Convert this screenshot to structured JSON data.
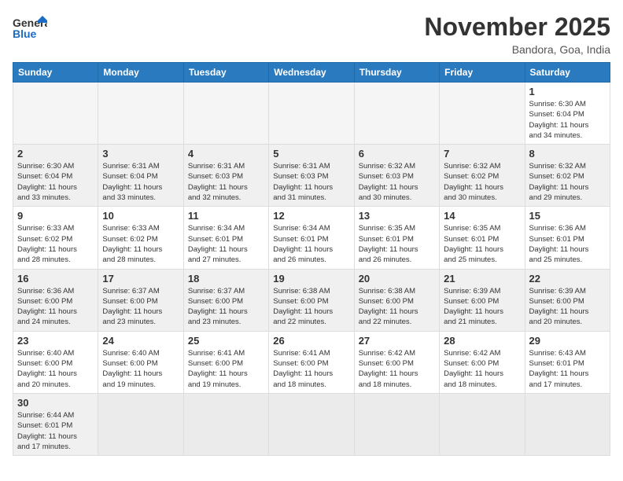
{
  "header": {
    "logo_general": "General",
    "logo_blue": "Blue",
    "title": "November 2025",
    "subtitle": "Bandora, Goa, India"
  },
  "weekdays": [
    "Sunday",
    "Monday",
    "Tuesday",
    "Wednesday",
    "Thursday",
    "Friday",
    "Saturday"
  ],
  "weeks": [
    [
      {
        "day": "",
        "info": ""
      },
      {
        "day": "",
        "info": ""
      },
      {
        "day": "",
        "info": ""
      },
      {
        "day": "",
        "info": ""
      },
      {
        "day": "",
        "info": ""
      },
      {
        "day": "",
        "info": ""
      },
      {
        "day": "1",
        "info": "Sunrise: 6:30 AM\nSunset: 6:04 PM\nDaylight: 11 hours\nand 34 minutes."
      }
    ],
    [
      {
        "day": "2",
        "info": "Sunrise: 6:30 AM\nSunset: 6:04 PM\nDaylight: 11 hours\nand 33 minutes."
      },
      {
        "day": "3",
        "info": "Sunrise: 6:31 AM\nSunset: 6:04 PM\nDaylight: 11 hours\nand 33 minutes."
      },
      {
        "day": "4",
        "info": "Sunrise: 6:31 AM\nSunset: 6:03 PM\nDaylight: 11 hours\nand 32 minutes."
      },
      {
        "day": "5",
        "info": "Sunrise: 6:31 AM\nSunset: 6:03 PM\nDaylight: 11 hours\nand 31 minutes."
      },
      {
        "day": "6",
        "info": "Sunrise: 6:32 AM\nSunset: 6:03 PM\nDaylight: 11 hours\nand 30 minutes."
      },
      {
        "day": "7",
        "info": "Sunrise: 6:32 AM\nSunset: 6:02 PM\nDaylight: 11 hours\nand 30 minutes."
      },
      {
        "day": "8",
        "info": "Sunrise: 6:32 AM\nSunset: 6:02 PM\nDaylight: 11 hours\nand 29 minutes."
      }
    ],
    [
      {
        "day": "9",
        "info": "Sunrise: 6:33 AM\nSunset: 6:02 PM\nDaylight: 11 hours\nand 28 minutes."
      },
      {
        "day": "10",
        "info": "Sunrise: 6:33 AM\nSunset: 6:02 PM\nDaylight: 11 hours\nand 28 minutes."
      },
      {
        "day": "11",
        "info": "Sunrise: 6:34 AM\nSunset: 6:01 PM\nDaylight: 11 hours\nand 27 minutes."
      },
      {
        "day": "12",
        "info": "Sunrise: 6:34 AM\nSunset: 6:01 PM\nDaylight: 11 hours\nand 26 minutes."
      },
      {
        "day": "13",
        "info": "Sunrise: 6:35 AM\nSunset: 6:01 PM\nDaylight: 11 hours\nand 26 minutes."
      },
      {
        "day": "14",
        "info": "Sunrise: 6:35 AM\nSunset: 6:01 PM\nDaylight: 11 hours\nand 25 minutes."
      },
      {
        "day": "15",
        "info": "Sunrise: 6:36 AM\nSunset: 6:01 PM\nDaylight: 11 hours\nand 25 minutes."
      }
    ],
    [
      {
        "day": "16",
        "info": "Sunrise: 6:36 AM\nSunset: 6:00 PM\nDaylight: 11 hours\nand 24 minutes."
      },
      {
        "day": "17",
        "info": "Sunrise: 6:37 AM\nSunset: 6:00 PM\nDaylight: 11 hours\nand 23 minutes."
      },
      {
        "day": "18",
        "info": "Sunrise: 6:37 AM\nSunset: 6:00 PM\nDaylight: 11 hours\nand 23 minutes."
      },
      {
        "day": "19",
        "info": "Sunrise: 6:38 AM\nSunset: 6:00 PM\nDaylight: 11 hours\nand 22 minutes."
      },
      {
        "day": "20",
        "info": "Sunrise: 6:38 AM\nSunset: 6:00 PM\nDaylight: 11 hours\nand 22 minutes."
      },
      {
        "day": "21",
        "info": "Sunrise: 6:39 AM\nSunset: 6:00 PM\nDaylight: 11 hours\nand 21 minutes."
      },
      {
        "day": "22",
        "info": "Sunrise: 6:39 AM\nSunset: 6:00 PM\nDaylight: 11 hours\nand 20 minutes."
      }
    ],
    [
      {
        "day": "23",
        "info": "Sunrise: 6:40 AM\nSunset: 6:00 PM\nDaylight: 11 hours\nand 20 minutes."
      },
      {
        "day": "24",
        "info": "Sunrise: 6:40 AM\nSunset: 6:00 PM\nDaylight: 11 hours\nand 19 minutes."
      },
      {
        "day": "25",
        "info": "Sunrise: 6:41 AM\nSunset: 6:00 PM\nDaylight: 11 hours\nand 19 minutes."
      },
      {
        "day": "26",
        "info": "Sunrise: 6:41 AM\nSunset: 6:00 PM\nDaylight: 11 hours\nand 18 minutes."
      },
      {
        "day": "27",
        "info": "Sunrise: 6:42 AM\nSunset: 6:00 PM\nDaylight: 11 hours\nand 18 minutes."
      },
      {
        "day": "28",
        "info": "Sunrise: 6:42 AM\nSunset: 6:00 PM\nDaylight: 11 hours\nand 18 minutes."
      },
      {
        "day": "29",
        "info": "Sunrise: 6:43 AM\nSunset: 6:01 PM\nDaylight: 11 hours\nand 17 minutes."
      }
    ],
    [
      {
        "day": "30",
        "info": "Sunrise: 6:44 AM\nSunset: 6:01 PM\nDaylight: 11 hours\nand 17 minutes."
      },
      {
        "day": "",
        "info": ""
      },
      {
        "day": "",
        "info": ""
      },
      {
        "day": "",
        "info": ""
      },
      {
        "day": "",
        "info": ""
      },
      {
        "day": "",
        "info": ""
      },
      {
        "day": "",
        "info": ""
      }
    ]
  ]
}
